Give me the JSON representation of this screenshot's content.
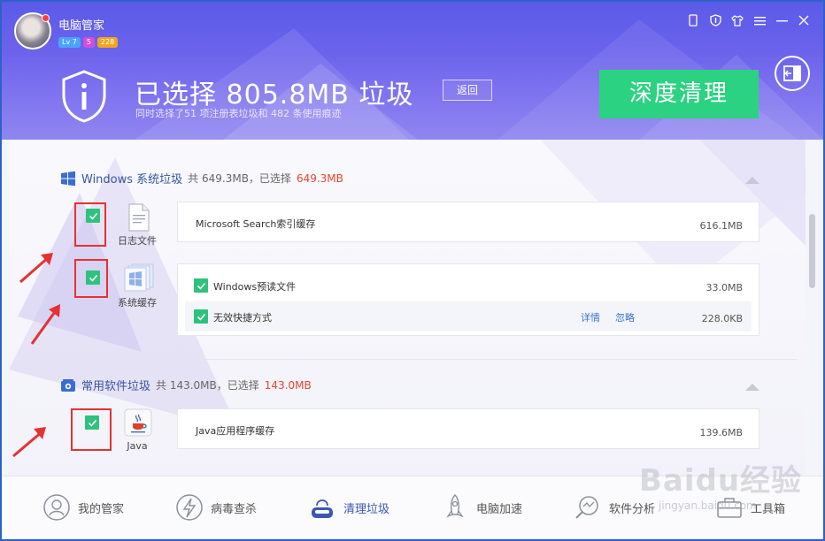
{
  "header": {
    "app_title": "电脑管家",
    "badges": {
      "level": "Lv 7",
      "points": "5",
      "money": "228"
    },
    "selected_title": "已选择 805.8MB 垃圾",
    "back_label": "返回",
    "subtitle": "同时选择了51 项注册表垃圾和 482 条使用痕迹",
    "deep_clean_label": "深度清理"
  },
  "sections": {
    "windows": {
      "name": "Windows 系统垃圾",
      "total": "共 649.3MB，已选择",
      "selected": "649.3MB",
      "categories": [
        {
          "label": "日志文件",
          "items": [
            {
              "name": "Microsoft Search索引缓存",
              "size": "616.1MB"
            }
          ]
        },
        {
          "label": "系统缓存",
          "items": [
            {
              "name": "Windows预读文件",
              "size": "33.0MB"
            },
            {
              "name": "无效快捷方式",
              "size": "228.0KB",
              "detail": "详情",
              "ignore": "忽略"
            }
          ]
        }
      ]
    },
    "software": {
      "name": "常用软件垃圾",
      "total": "共 143.0MB，已选择",
      "selected": "143.0MB",
      "categories": [
        {
          "label": "Java",
          "items": [
            {
              "name": "Java应用程序缓存",
              "size": "139.6MB"
            }
          ]
        }
      ]
    }
  },
  "nav": [
    {
      "label": "我的管家"
    },
    {
      "label": "病毒查杀"
    },
    {
      "label": "清理垃圾"
    },
    {
      "label": "电脑加速"
    },
    {
      "label": "软件分析"
    },
    {
      "label": "工具箱"
    }
  ],
  "watermark": {
    "brand": "Baidu经验",
    "url": "jingyan.baidu.com"
  },
  "colors": {
    "accent_green": "#2bd281",
    "header_blue": "#5a5be8",
    "highlight_red": "#e8462c",
    "link_blue": "#3a74c9"
  }
}
